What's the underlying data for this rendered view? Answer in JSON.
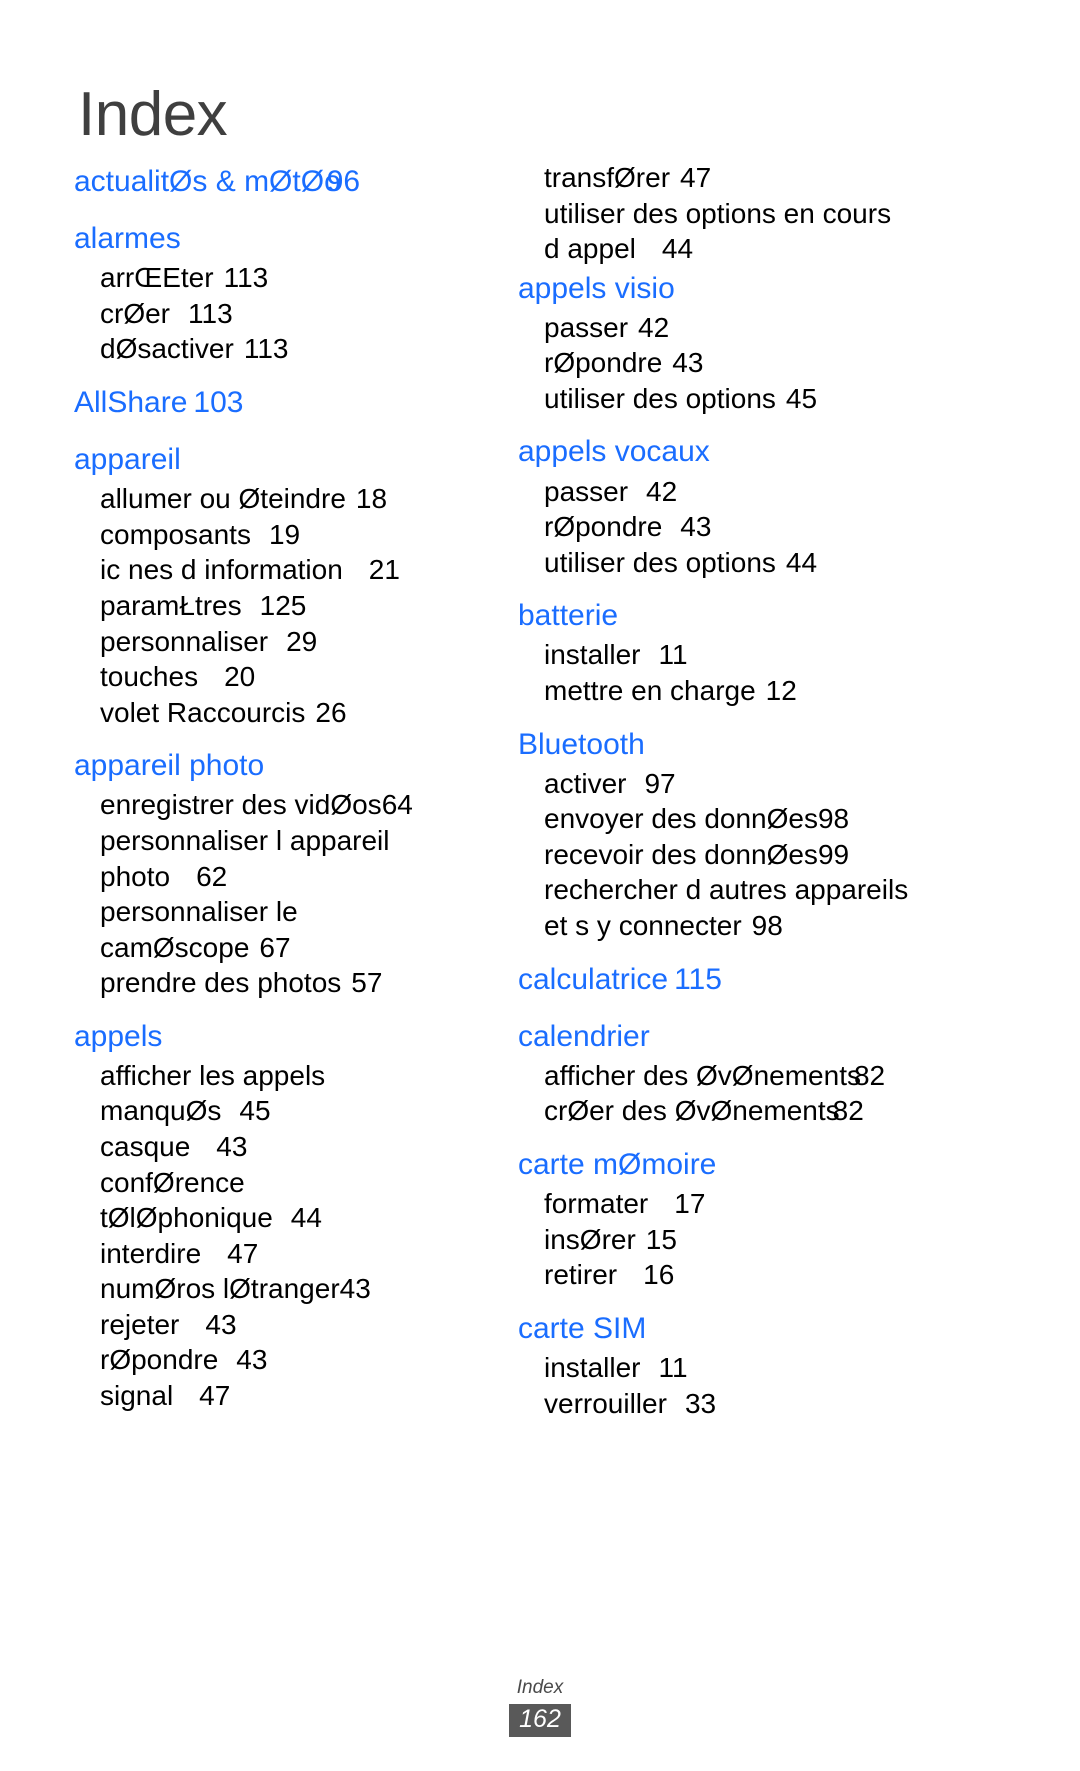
{
  "document": {
    "title": "Index",
    "accent_color": "#1a6dff",
    "title_color": "#3f3f3f",
    "footer_badge_color": "#595959"
  },
  "footer": {
    "label": "Index",
    "page_number": "162"
  },
  "left_column": [
    {
      "type": "heading",
      "label": "actualitØs & mØtØo",
      "page": "96",
      "collide": true
    },
    {
      "type": "heading",
      "label": "alarmes",
      "page": ""
    },
    {
      "type": "sub",
      "label": "arrŒEter",
      "page": "113",
      "gap": 1
    },
    {
      "type": "sub",
      "label": "crØer",
      "page": "113",
      "gap": 2
    },
    {
      "type": "sub",
      "label": "dØsactiver",
      "page": "113",
      "gap": 1
    },
    {
      "type": "heading",
      "label": "AllShare",
      "page": "103"
    },
    {
      "type": "heading",
      "label": "appareil",
      "page": ""
    },
    {
      "type": "sub",
      "label": "allumer ou Øteindre",
      "page": "18",
      "gap": 1
    },
    {
      "type": "sub",
      "label": "composants",
      "page": "19",
      "gap": 2
    },
    {
      "type": "sub",
      "label": "ic nes d information",
      "page": "21",
      "gap": 3
    },
    {
      "type": "sub",
      "label": "paramŁtres",
      "page": "125",
      "gap": 2
    },
    {
      "type": "sub",
      "label": "personnaliser",
      "page": "29",
      "gap": 2
    },
    {
      "type": "sub",
      "label": "touches",
      "page": "20",
      "gap": 3
    },
    {
      "type": "sub",
      "label": "volet Raccourcis",
      "page": "26",
      "gap": 1
    },
    {
      "type": "heading",
      "label": "appareil photo",
      "page": ""
    },
    {
      "type": "sub",
      "label": "enregistrer des vidØos",
      "page": "64",
      "gap": 0
    },
    {
      "type": "sub",
      "label": "personnaliser l appareil",
      "page": "",
      "gap": 1
    },
    {
      "type": "sub",
      "label": "photo",
      "page": "62",
      "gap": 3,
      "cont": true
    },
    {
      "type": "sub",
      "label": "personnaliser le",
      "page": "",
      "gap": 1
    },
    {
      "type": "sub",
      "label": "camØscope",
      "page": "67",
      "gap": 1,
      "cont": true
    },
    {
      "type": "sub",
      "label": "prendre des photos",
      "page": "57",
      "gap": 1
    },
    {
      "type": "heading",
      "label": "appels",
      "page": ""
    },
    {
      "type": "sub",
      "label": "afficher les appels",
      "page": "",
      "gap": 1
    },
    {
      "type": "sub",
      "label": "manquØs",
      "page": "45",
      "gap": 2,
      "cont": true
    },
    {
      "type": "sub",
      "label": "casque",
      "page": "43",
      "gap": 3
    },
    {
      "type": "sub",
      "label": "confØrence",
      "page": "",
      "gap": 1
    },
    {
      "type": "sub",
      "label": "tØlØphonique",
      "page": "44",
      "gap": 2,
      "cont": true
    },
    {
      "type": "sub",
      "label": "interdire",
      "page": "47",
      "gap": 3
    },
    {
      "type": "sub",
      "label": "numØros   lØtranger",
      "page": "43",
      "gap": 0
    },
    {
      "type": "sub",
      "label": "rejeter",
      "page": "43",
      "gap": 3
    },
    {
      "type": "sub",
      "label": "rØpondre",
      "page": "43",
      "gap": 2
    },
    {
      "type": "sub",
      "label": "signal",
      "page": "47",
      "gap": 3
    }
  ],
  "right_column": [
    {
      "type": "sub",
      "label": "transfØrer",
      "page": "47",
      "gap": 1
    },
    {
      "type": "sub",
      "label": "utiliser des options en cours",
      "page": "",
      "gap": 1
    },
    {
      "type": "sub",
      "label": "d appel",
      "page": "44",
      "gap": 3,
      "cont": true
    },
    {
      "type": "heading",
      "label": "appels visio",
      "page": ""
    },
    {
      "type": "sub",
      "label": "passer",
      "page": "42",
      "gap": 1
    },
    {
      "type": "sub",
      "label": "rØpondre",
      "page": "43",
      "gap": 1
    },
    {
      "type": "sub",
      "label": "utiliser des options",
      "page": "45",
      "gap": 1
    },
    {
      "type": "heading",
      "label": "appels vocaux",
      "page": ""
    },
    {
      "type": "sub",
      "label": "passer",
      "page": "42",
      "gap": 2
    },
    {
      "type": "sub",
      "label": "rØpondre",
      "page": "43",
      "gap": 2
    },
    {
      "type": "sub",
      "label": "utiliser des options",
      "page": "44",
      "gap": 1
    },
    {
      "type": "heading",
      "label": "batterie",
      "page": ""
    },
    {
      "type": "sub",
      "label": "installer",
      "page": "11",
      "gap": 2
    },
    {
      "type": "sub",
      "label": "mettre en charge",
      "page": "12",
      "gap": 1
    },
    {
      "type": "heading",
      "label": "Bluetooth",
      "page": ""
    },
    {
      "type": "sub",
      "label": "activer",
      "page": "97",
      "gap": 2
    },
    {
      "type": "sub",
      "label": "envoyer des donnØes",
      "page": "98",
      "gap": 0
    },
    {
      "type": "sub",
      "label": "recevoir des donnØes",
      "page": "99",
      "gap": 0
    },
    {
      "type": "sub",
      "label": "rechercher d autres appareils",
      "page": "",
      "gap": 1
    },
    {
      "type": "sub",
      "label": "et s y connecter",
      "page": "98",
      "gap": 1,
      "cont": true
    },
    {
      "type": "heading",
      "label": "calculatrice",
      "page": "115",
      "wide": true
    },
    {
      "type": "heading",
      "label": "calendrier",
      "page": ""
    },
    {
      "type": "sub",
      "label": "afficher des ØvØnements",
      "page": "82",
      "gap": -1
    },
    {
      "type": "sub",
      "label": "crØer des ØvØnements",
      "page": "82",
      "gap": -1
    },
    {
      "type": "heading",
      "label": "carte mØmoire",
      "page": ""
    },
    {
      "type": "sub",
      "label": "formater",
      "page": "17",
      "gap": 3
    },
    {
      "type": "sub",
      "label": "insØrer",
      "page": "15",
      "gap": 1
    },
    {
      "type": "sub",
      "label": "retirer",
      "page": "16",
      "gap": 3
    },
    {
      "type": "heading",
      "label": "carte SIM",
      "page": ""
    },
    {
      "type": "sub",
      "label": "installer",
      "page": "11",
      "gap": 2
    },
    {
      "type": "sub",
      "label": "verrouiller",
      "page": "33",
      "gap": 2
    }
  ]
}
